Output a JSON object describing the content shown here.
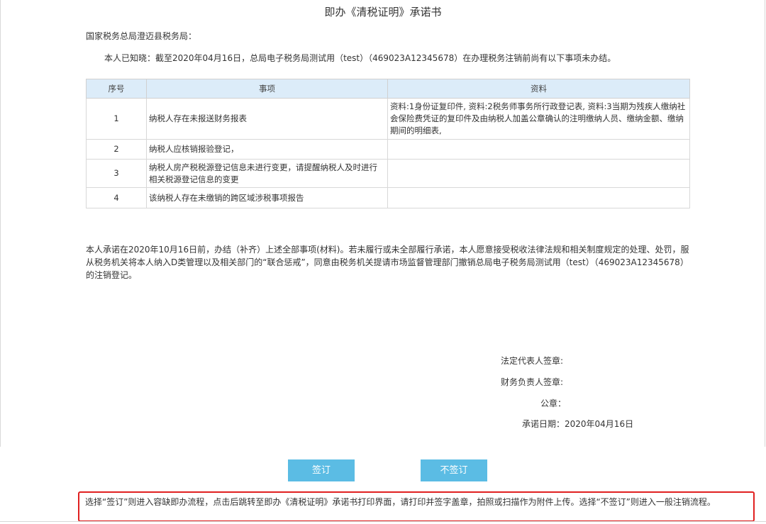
{
  "document": {
    "title": "即办《清税证明》承诺书",
    "addressee": "国家税务总局澄迈县税务局：",
    "notice": "本人已知晓：截至2020年04月16日，总局电子税务局测试用（test）（469023A12345678）在办理税务注销前尚有以下事项未办结。"
  },
  "table": {
    "headers": [
      "序号",
      "事项",
      "资料"
    ],
    "rows": [
      {
        "no": "1",
        "item": "纳税人存在未报送财务报表",
        "material": "资料:1身份证复印件, 资料:2税务师事务所行政登记表, 资料:3当期为残疾人缴纳社会保险费凭证的复印件及由纳税人加盖公章确认的注明缴纳人员、缴纳金额、缴纳期间的明细表,"
      },
      {
        "no": "2",
        "item": "纳税人应核销报验登记，",
        "material": ""
      },
      {
        "no": "3",
        "item": "纳税人房产税税源登记信息未进行变更，请提醒纳税人及时进行相关税源登记信息的变更",
        "material": ""
      },
      {
        "no": "4",
        "item": "该纳税人存在未缴销的跨区域涉税事项报告",
        "material": ""
      }
    ]
  },
  "commitment": "本人承诺在2020年10月16日前，办结（补齐）上述全部事项(材料)。若未履行或未全部履行承诺，本人愿意接受税收法律法规和相关制度规定的处理、处罚，服从税务机关将本人纳入D类管理以及相关部门的“联合惩戒”，同意由税务机关提请市场监督管理部门撤销总局电子税务局测试用（test）（469023A12345678）的注销登记。",
  "signatures": {
    "legal_rep": "法定代表人签章:",
    "finance_head": "财务负责人签章:",
    "seal": "公章：",
    "date": "承诺日期：2020年04月16日"
  },
  "buttons": {
    "sign": "签订",
    "not_sign": "不签订"
  },
  "hint": "选择“签订”则进入容缺即办流程，点击后跳转至即办《清税证明》承诺书打印界面，请打印并签字盖章，拍照或扫描作为附件上传。选择“不签订”则进入一般注销流程。",
  "colors": {
    "button": "#5bbce4",
    "table_header": "#dcecf9",
    "hint_border": "#e02020"
  }
}
